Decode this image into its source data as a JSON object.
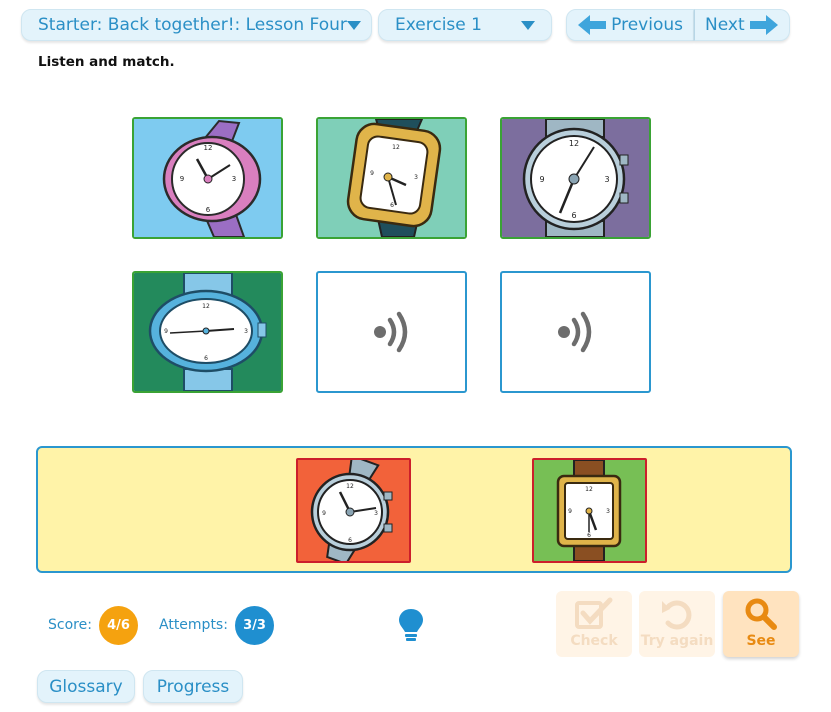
{
  "header": {
    "lesson_select": "Starter: Back together!: Lesson Four",
    "exercise_select": "Exercise 1",
    "previous_label": "Previous",
    "next_label": "Next"
  },
  "instruction": "Listen and match.",
  "grid": {
    "cards": [
      {
        "state": "matched",
        "image": "pink-wristwatch",
        "bg": "#7ecbf0"
      },
      {
        "state": "matched",
        "image": "gold-rectangular-watch",
        "bg": "#7fcfb8"
      },
      {
        "state": "matched",
        "image": "silver-round-watch",
        "bg": "#7c6e9e"
      },
      {
        "state": "matched",
        "image": "blue-oval-watch",
        "bg": "#238a5c"
      },
      {
        "state": "empty",
        "image": "audio-icon"
      },
      {
        "state": "empty",
        "image": "audio-icon"
      }
    ]
  },
  "tray": {
    "cards": [
      {
        "image": "silver-tilted-watch",
        "bg": "#f2623a"
      },
      {
        "image": "gold-square-brown-strap-watch",
        "bg": "#77bf55"
      }
    ]
  },
  "status": {
    "score_label": "Score:",
    "score_value": "4/6",
    "attempts_label": "Attempts:",
    "attempts_value": "3/3",
    "score_color": "#f5a20f",
    "attempts_color": "#1f8fd0"
  },
  "actions": {
    "check_label": "Check",
    "try_again_label": "Try again",
    "see_label": "See"
  },
  "footer": {
    "glossary_label": "Glossary",
    "progress_label": "Progress"
  }
}
